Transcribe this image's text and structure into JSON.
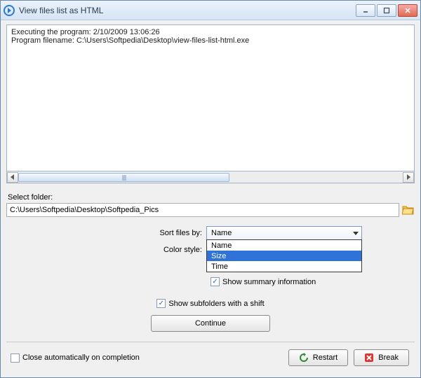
{
  "window": {
    "title": "View files list as HTML"
  },
  "log": {
    "line1_prefix": "Executing the program:  ",
    "line1_datetime": "2/10/2009 13:06:26",
    "line2_prefix": "Program filename: ",
    "line2_path": "C:\\Users\\Softpedia\\Desktop\\view-files-list-html.exe"
  },
  "folder": {
    "label": "Select folder:",
    "path": "C:\\Users\\Softpedia\\Desktop\\Softpedia_Pics"
  },
  "sort": {
    "label": "Sort files by:",
    "value": "Name",
    "options": [
      "Name",
      "Size",
      "Time"
    ],
    "highlighted": "Size"
  },
  "color": {
    "label": "Color style:"
  },
  "summary": {
    "label": "Show summary information",
    "checked": true
  },
  "subfolders": {
    "label": "Show subfolders with a shift",
    "checked": true
  },
  "continue": {
    "label": "Continue"
  },
  "close_on_completion": {
    "label": "Close automatically on completion",
    "checked": false
  },
  "restart": {
    "label": "Restart"
  },
  "break": {
    "label": "Break"
  }
}
